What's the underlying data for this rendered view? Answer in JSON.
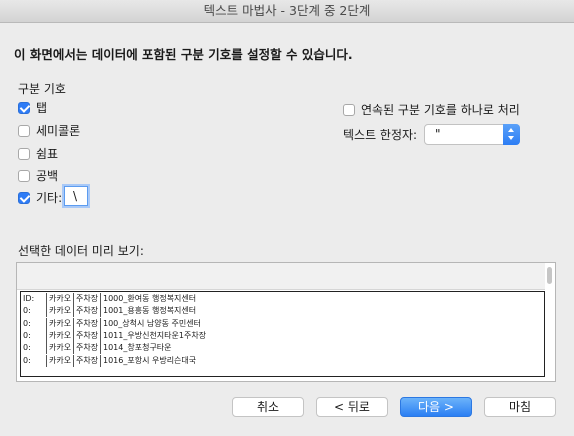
{
  "window": {
    "title": "텍스트 마법사 - 3단계 중 2단계"
  },
  "heading": "이 화면에서는 데이터에 포함된 구분 기호를 설정할 수 있습니다.",
  "delimiters": {
    "section_label": "구분 기호",
    "tab": {
      "label": "탭",
      "checked": true
    },
    "semicolon": {
      "label": "세미콜론",
      "checked": false
    },
    "comma": {
      "label": "쉼표",
      "checked": false
    },
    "space": {
      "label": "공백",
      "checked": false
    },
    "other": {
      "label": "기타:",
      "checked": true,
      "value": "\\"
    }
  },
  "consecutive": {
    "label": "연속된 구분 기호를 하나로 처리",
    "checked": false
  },
  "text_qualifier": {
    "label": "텍스트 한정자:",
    "value": "\""
  },
  "preview": {
    "label": "선택한 데이터 미리 보기:",
    "rows": [
      [
        "ID:",
        "카카오",
        "주차장",
        "1000_환여동 행정복지센터"
      ],
      [
        "0:",
        "카카오",
        "주차장",
        "1001_용흥동 행정복지센터"
      ],
      [
        "0:",
        "카카오",
        "주차장",
        "100_상척시 남양동 주민센터"
      ],
      [
        "0:",
        "카카오",
        "주차장",
        "1011_우방신천지타운1주차장"
      ],
      [
        "0:",
        "카카오",
        "주차장",
        "1014_창포청구타운"
      ],
      [
        "0:",
        "카카오",
        "주차장",
        "1016_포항시 우방리슨대국"
      ]
    ]
  },
  "buttons": {
    "cancel": "취소",
    "back": "< 뒤로",
    "next": "다음 >",
    "finish": "마침"
  }
}
